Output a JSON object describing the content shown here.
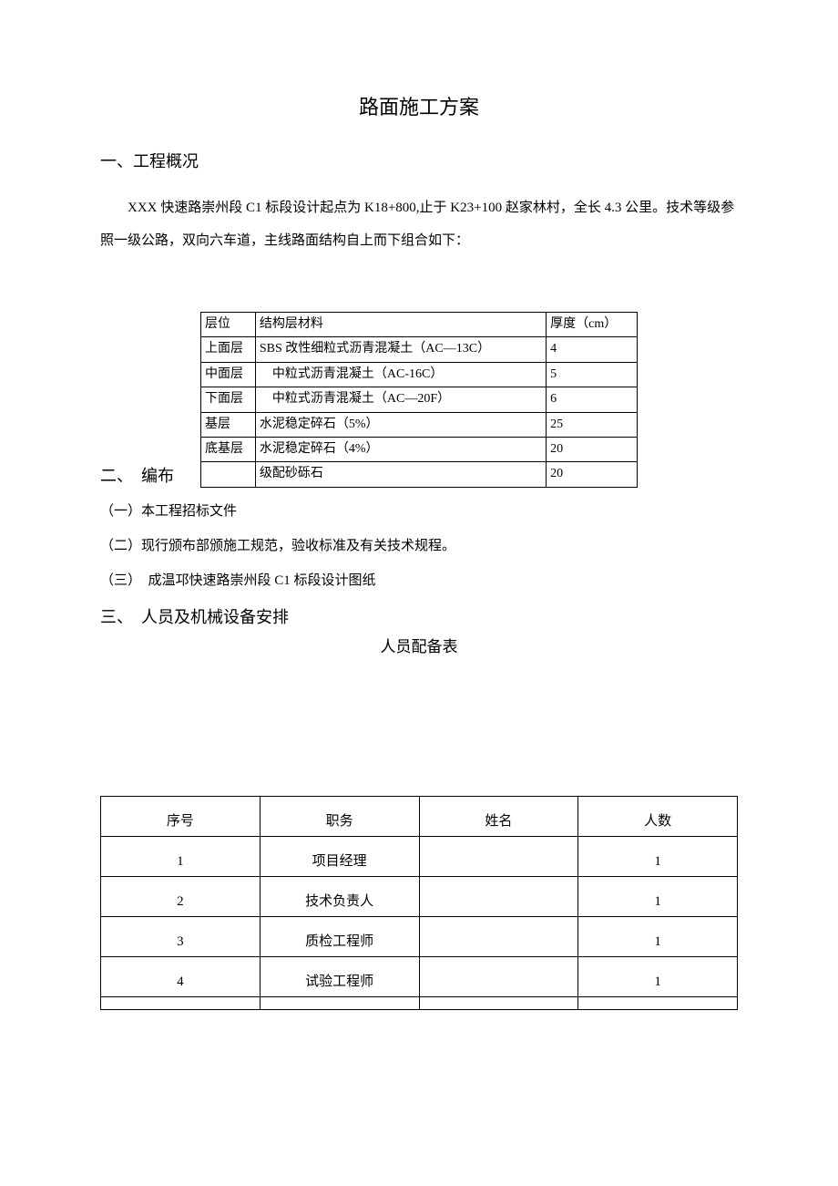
{
  "title": "路面施工方案",
  "sec1": {
    "heading": "一、工程概况",
    "para": "XXX 快速路崇州段 C1 标段设计起点为 K18+800,止于 K23+100 赵家林村，全长 4.3 公里。技术等级参照一级公路，双向六车道，主线路面结构自上而下组合如下："
  },
  "table1": {
    "header": {
      "c0": "层位",
      "c1": "结构层材料",
      "c2": "厚度（cm）"
    },
    "rows": [
      {
        "c0": "上面层",
        "c1": "SBS 改性细粒式沥青混凝土（AC—13C）",
        "c2": "4"
      },
      {
        "c0": "中面层",
        "c1": "中粒式沥青混凝土（AC-16C）",
        "c2": "5",
        "pad": true
      },
      {
        "c0": "下面层",
        "c1": "中粒式沥青混凝土（AC—20F）",
        "c2": "6",
        "pad": true
      },
      {
        "c0": "基层",
        "c1": "水泥稳定碎石（5%）",
        "c2": "25"
      },
      {
        "c0": "底基层",
        "c1": "水泥稳定碎石（4%）",
        "c2": "20"
      },
      {
        "c0": "",
        "c1": "级配砂砾石",
        "c2": "20"
      }
    ]
  },
  "sec2": {
    "heading": "二、　编布",
    "items": [
      "（一）本工程招标文件",
      "（二）现行颁布部颁施工规范，验收标准及有关技术规程。",
      "（三）　成温邛快速路崇州段 C1 标段设计图纸"
    ]
  },
  "sec3": {
    "heading": "三、　人员及机械设备安排",
    "subtitle": "人员配备表"
  },
  "table2": {
    "header": {
      "c0": "序号",
      "c1": "职务",
      "c2": "姓名",
      "c3": "人数"
    },
    "rows": [
      {
        "c0": "1",
        "c1": "项目经理",
        "c2": "",
        "c3": "1"
      },
      {
        "c0": "2",
        "c1": "技术负责人",
        "c2": "",
        "c3": "1"
      },
      {
        "c0": "3",
        "c1": "质检工程师",
        "c2": "",
        "c3": "1"
      },
      {
        "c0": "4",
        "c1": "试验工程师",
        "c2": "",
        "c3": "1"
      }
    ]
  }
}
